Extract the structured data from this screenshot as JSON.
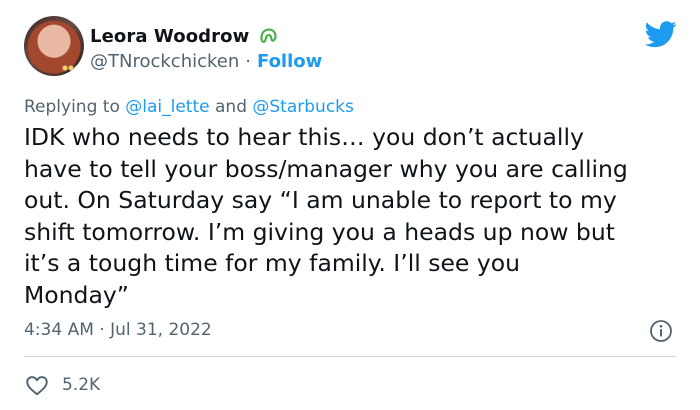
{
  "author": {
    "display_name": "Leora Woodrow",
    "handle": "@TNrockchicken",
    "separator": "·",
    "follow_label": "Follow"
  },
  "reply": {
    "prefix": "Replying to",
    "mention_1": "@lai_lette",
    "conjunction": "and",
    "mention_2": "@Starbucks"
  },
  "tweet": {
    "text": "IDK who needs to hear this… you don’t actually\nhave to tell your boss/manager why you are calling\nout. On Saturday say “I am unable to report to my\nshift tomorrow. I’m giving you a heads up now but\nit’s a tough time for my family. I’ll see you\nMonday”"
  },
  "meta": {
    "timestamp": "4:34 AM · Jul 31, 2022"
  },
  "stats": {
    "likes": "5.2K"
  },
  "colors": {
    "accent": "#1d9bf0",
    "secondary_text": "#536471",
    "primary_text": "#0f1419",
    "badge_green": "#4caf50"
  },
  "icons": {
    "badge": "green-tooth-badge-icon",
    "brand": "twitter-bird-icon",
    "info": "info-icon",
    "like": "heart-icon"
  }
}
